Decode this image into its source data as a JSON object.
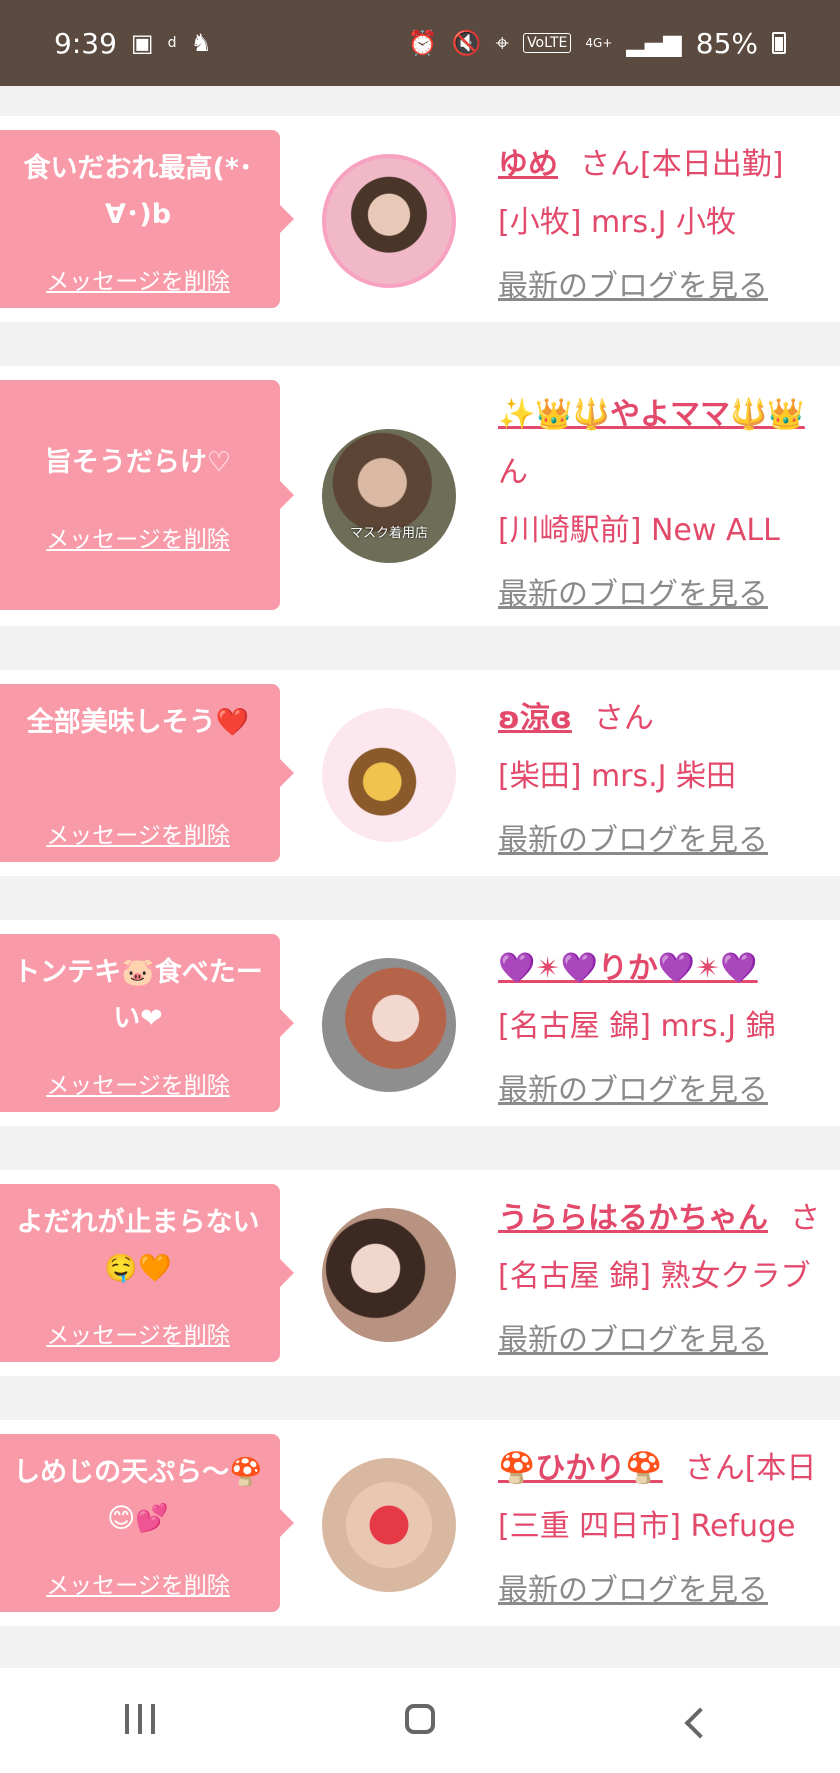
{
  "status_bar": {
    "time": "9:39",
    "battery": "85%",
    "network": "VoLTE",
    "signal_label": "4G+",
    "icons": [
      "image-icon",
      "d-health-icon",
      "app-icon",
      "alarm-icon",
      "mute-icon",
      "location-icon",
      "signal-icon",
      "battery-icon"
    ]
  },
  "delete_label": "メッセージを削除",
  "blog_label": "最新のブログを見る",
  "san_label": "さん",
  "entries": [
    {
      "message": "食いだおれ最高(*･∀･)b",
      "name": "ゆめ",
      "suffix": "さん[本日出勤]",
      "shop": "[小牧] mrs.J 小牧"
    },
    {
      "message": "旨そうだらけ♡",
      "name": "✨👑🔱やよママ🔱👑",
      "name_cont": "ん",
      "shop": "[川崎駅前] New ALL",
      "avatar_caption": "マスク着用店"
    },
    {
      "message": "全部美味しそう❤️",
      "name": "ʚ涼ɞ",
      "suffix": "さん",
      "shop": "[柴田] mrs.J 柴田"
    },
    {
      "message": "トンテキ🐷食べたーい❤",
      "name": "💜✴💜りか💜✴💜",
      "shop": "[名古屋 錦] mrs.J 錦"
    },
    {
      "message": "よだれが止まらない🤤🧡",
      "name": "うららはるかちゃん",
      "suffix": "さ",
      "shop": "[名古屋 錦] 熟女クラブ"
    },
    {
      "message": "しめじの天ぷら〜🍄😊💕",
      "name": "🍄ひかり🍄",
      "suffix": "さん[本日",
      "shop": "[三重 四日市] Refuge"
    }
  ],
  "colors": {
    "status_bar": "#5b4a3f",
    "bubble": "#f99aa9",
    "accent": "#e2496a",
    "link_gray": "#8a8a8a",
    "background": "#f2f2f2"
  },
  "nav": {
    "icons": [
      "recents-icon",
      "home-icon",
      "back-icon"
    ]
  }
}
